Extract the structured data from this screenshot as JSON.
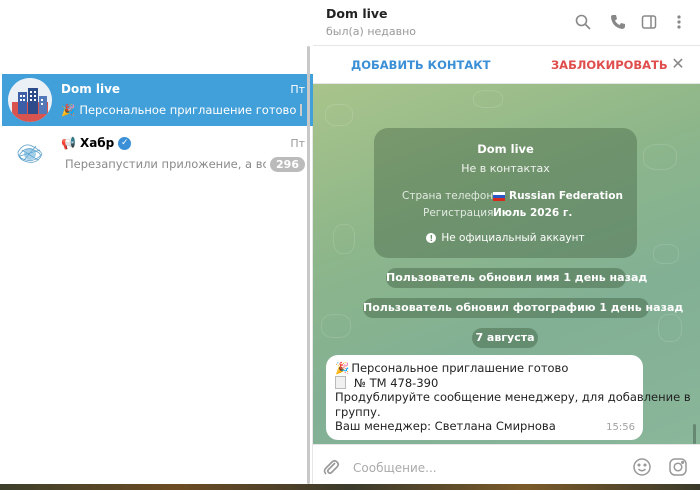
{
  "sidebar": {
    "chats": [
      {
        "name": "Dom live",
        "date": "Пт",
        "preview_prefix": "🎉",
        "preview": "Персональное приглашение готово",
        "preview_suffix": "№",
        "active": true
      },
      {
        "name": "Хабр",
        "name_prefix": "📢",
        "date": "Пт",
        "preview": "Перезапустили приложение, а все ег...",
        "unread": "296",
        "verified": true,
        "active": false
      }
    ]
  },
  "header": {
    "title": "Dom live",
    "subtitle": "был(а) недавно",
    "icons": [
      "search-icon",
      "phone-icon",
      "sidebar-toggle-icon",
      "more-icon"
    ]
  },
  "action_bar": {
    "add_contact": "ДОБАВИТЬ КОНТАКТ",
    "block": "ЗАБЛОКИРОВАТЬ",
    "close": "✕"
  },
  "info_card": {
    "title": "Dom live",
    "subtitle": "Не в контактах",
    "phone_country_label": "Страна телефона",
    "phone_country_value": "Russian Federation",
    "registration_label": "Регистрация",
    "registration_value": "Июль 2026 г.",
    "note": "Не официальный аккаунт"
  },
  "service_messages": [
    "Пользователь обновил имя 1 день назад",
    "Пользователь обновил фотографию 1 день назад",
    "7 августа"
  ],
  "message": {
    "line1": "Персональное приглашение готово",
    "line2": "№ ТМ 478-390",
    "line3": "Продублируйте сообщение менеджеру, для добавление в",
    "line4": "группу.",
    "line5": "Ваш менеджер: Светлана Смирнова",
    "time": "15:56"
  },
  "composer": {
    "placeholder": "Сообщение..."
  },
  "colors": {
    "accent": "#419fd9",
    "link": "#3a8fd6",
    "danger": "#e04d4d",
    "badge": "#bbbbbb"
  }
}
